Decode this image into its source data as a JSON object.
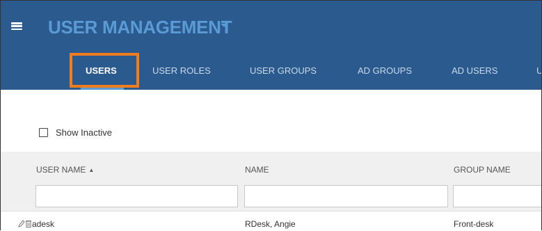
{
  "header": {
    "title": "USER MANAGEMENT",
    "tabs": [
      {
        "label": "USERS",
        "active": true
      },
      {
        "label": "USER ROLES",
        "active": false
      },
      {
        "label": "USER GROUPS",
        "active": false
      },
      {
        "label": "AD GROUPS",
        "active": false
      },
      {
        "label": "AD USERS",
        "active": false
      },
      {
        "label": "U",
        "active": false
      }
    ]
  },
  "filters": {
    "show_inactive_label": "Show Inactive",
    "show_inactive_checked": false
  },
  "grid": {
    "columns": [
      {
        "label": "USER NAME",
        "sortable": true
      },
      {
        "label": "NAME",
        "sortable": false
      },
      {
        "label": "GROUP NAME",
        "sortable": false
      }
    ],
    "rows": [
      {
        "user_name": "adesk",
        "name": "RDesk, Angie",
        "group_name": "Front-desk"
      }
    ]
  },
  "colors": {
    "header_bg": "#2b5a8e",
    "title": "#5a9bd5",
    "highlight": "#f07e1f"
  },
  "icons": [
    "menu-icon",
    "caret-down-icon",
    "sort-icon",
    "edit-icon",
    "delete-icon"
  ]
}
